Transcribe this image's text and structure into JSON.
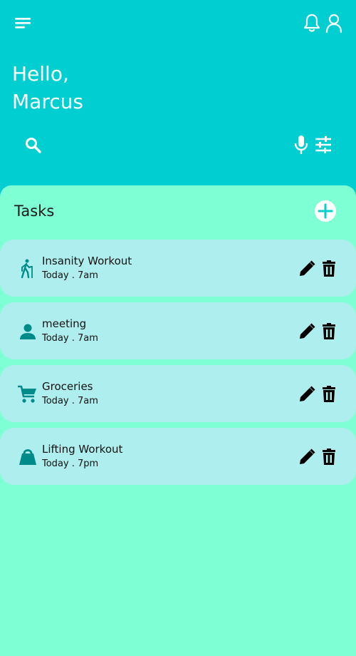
{
  "header": {
    "greeting_line1": "Hello,",
    "greeting_line2": "Marcus",
    "icons": [
      "menu-icon",
      "bell-icon",
      "user-icon",
      "search-icon",
      "mic-icon",
      "filter-icon"
    ]
  },
  "tasks_panel": {
    "title": "Tasks",
    "add_icon": "add-icon"
  },
  "tasks": [
    {
      "name": "Insanity Workout",
      "time": "Today . 7am",
      "icon": "hiking-icon"
    },
    {
      "name": "meeting",
      "time": "Today . 7am",
      "icon": "person-icon"
    },
    {
      "name": "Groceries",
      "time": "Today . 7am",
      "icon": "cart-icon"
    },
    {
      "name": "Lifting Workout",
      "time": "Today . 7pm",
      "icon": "weight-icon"
    }
  ],
  "colors": {
    "header_bg": "#00CED1",
    "panel_bg": "#7FFFD4",
    "card_bg": "#AFEEEE",
    "task_icon": "#008B8B",
    "action_icon": "#000000"
  }
}
